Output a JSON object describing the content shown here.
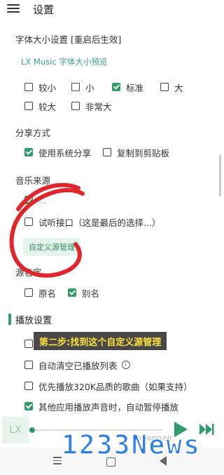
{
  "header": {
    "title": "设置"
  },
  "font_size": {
    "title": "字体大小设置 [重启后生效]",
    "preview": "LX Music 字体大小预览",
    "options": [
      {
        "label": "较小",
        "checked": false
      },
      {
        "label": "小",
        "checked": false
      },
      {
        "label": "标准",
        "checked": true
      },
      {
        "label": "大",
        "checked": false
      },
      {
        "label": "较大",
        "checked": false
      },
      {
        "label": "非常大",
        "checked": false
      }
    ]
  },
  "share": {
    "title": "分享方式",
    "options": [
      {
        "label": "使用系统分享",
        "checked": true
      },
      {
        "label": "复制到剪贴板",
        "checked": false
      }
    ]
  },
  "music_source": {
    "title": "音乐来源",
    "options": [
      {
        "label": "...",
        "checked": true
      },
      {
        "label": "试听接口（这是最后的选择...）",
        "checked": false
      }
    ],
    "custom_button": "自定义源管理"
  },
  "source_name": {
    "title": "源名字",
    "options": [
      {
        "label": "原名",
        "checked": false
      },
      {
        "label": "别名",
        "checked": true
      }
    ]
  },
  "playback": {
    "title": "播放设置",
    "options": [
      {
        "label": "",
        "checked": false
      },
      {
        "label": "自动清空已播放列表",
        "checked": false
      },
      {
        "label": "优先播放320K品质的歌曲（如果支持）",
        "checked": false
      },
      {
        "label": "其他应用播放声音时，自动暂停播放",
        "checked": true
      }
    ]
  },
  "caption": "第二步:找到这个自定义源管理",
  "player": {
    "cover_text": "LX",
    "time": "00:00/00:00"
  },
  "watermark": "1233News",
  "colors": {
    "accent": "#2e9c6b",
    "annotation": "#e0262a",
    "watermark": "#2f7fe8"
  },
  "icons": {
    "menu": "hamburger-icon",
    "info": "info-icon",
    "play": "play-icon",
    "next": "skip-next-icon"
  }
}
